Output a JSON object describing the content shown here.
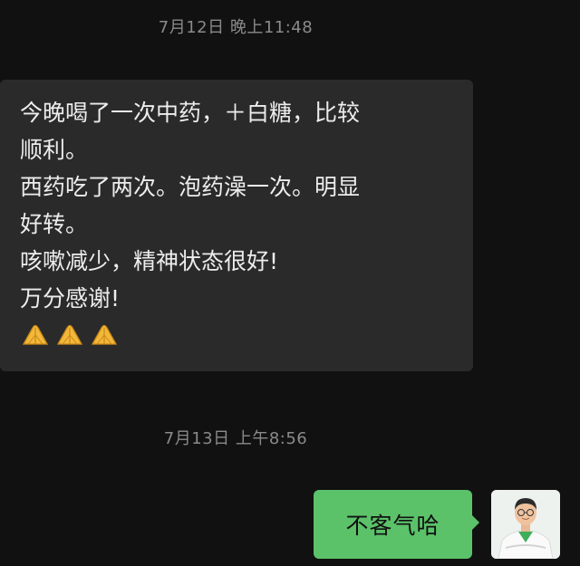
{
  "chat": {
    "timestamp_1": "7月12日 晚上11:48",
    "incoming_message": {
      "lines": [
        "今晚喝了一次中药，＋白糖，比较",
        "顺利。",
        "西药吃了两次。泡药澡一次。明显",
        "好转。",
        "咳嗽减少，精神状态很好!",
        "万分感谢!"
      ],
      "emoji": [
        "🙏",
        "🙏",
        "🙏"
      ]
    },
    "timestamp_2": "7月13日 上午8:56",
    "outgoing_message": {
      "text": "不客气哈"
    }
  },
  "colors": {
    "background": "#111111",
    "incoming_bubble": "#2a2a2a",
    "outgoing_bubble": "#5bc26a",
    "timestamp_text": "#8a8a8a"
  },
  "icons": {
    "emoji": "folded-hands-icon",
    "avatar": "doctor-avatar"
  }
}
